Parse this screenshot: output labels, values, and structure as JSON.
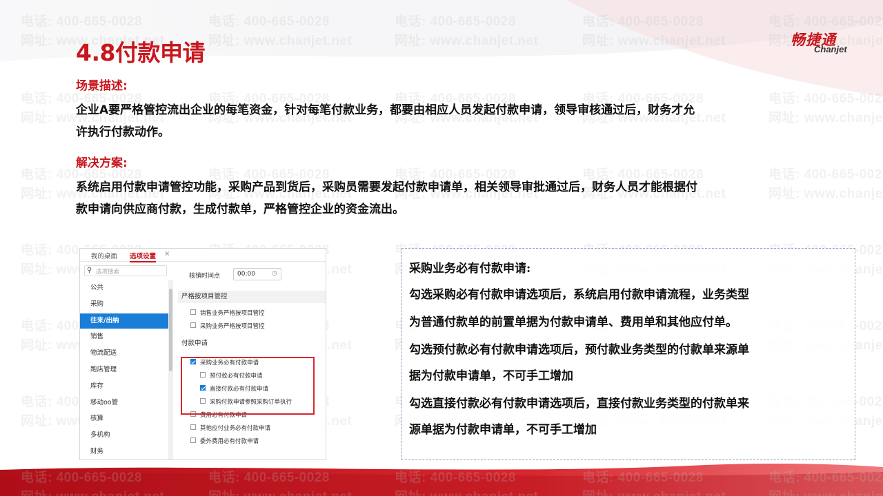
{
  "slide": {
    "title": "4.8付款申请",
    "logo_cn": "畅捷通",
    "logo_en": "Chanjet",
    "watermark_phone": "电话: 400-665-0028",
    "watermark_site": "网址: www.chanjet.net",
    "scene_heading": "场景描述:",
    "scene_lines": [
      "企业A要严格管控流出企业的每笔资金，针对每笔付款业务，都要由相应人员发起付款申请，领导审核通过后，财务才允",
      "许执行付款动作。"
    ],
    "solution_heading": "解决方案:",
    "solution_lines": [
      "系统启用付款申请管控功能，采购产品到货后，采购员需要发起付款申请单，相关领导审批通过后，财务人员才能根据付",
      "款申请向供应商付款，生成付款单，严格管控企业的资金流出。"
    ]
  },
  "screenshot": {
    "tabs": [
      "我的桌面",
      "选项设置"
    ],
    "tab_close": "×",
    "search_placeholder": "选项搜索",
    "sidebar_items": [
      "公共",
      "采购",
      "往来/出纳",
      "销售",
      "物流配送",
      "跑店管理",
      "库存",
      "移动oo管",
      "核算",
      "多机构",
      "财务"
    ],
    "active_sidebar_index": 2,
    "time_label": "核销时间点",
    "time_value": "00:00",
    "section_project": "严格按项目管控",
    "project_options": [
      {
        "label": "销售业务严格按项目管控",
        "checked": false
      },
      {
        "label": "采购业务严格按项目管控",
        "checked": false
      }
    ],
    "section_payment": "付款申请",
    "payment_options": [
      {
        "label": "采购业务必有付款申请",
        "checked": true,
        "indent": 0
      },
      {
        "label": "预付款必有付款申请",
        "checked": false,
        "indent": 1
      },
      {
        "label": "直接付款必有付款申请",
        "checked": true,
        "indent": 1
      },
      {
        "label": "采购付款申请参照采购订单执行",
        "checked": false,
        "indent": 1
      },
      {
        "label": "费用必有付款申请",
        "checked": false,
        "indent": 0
      },
      {
        "label": "其他应付业务必有付款申请",
        "checked": false,
        "indent": 0
      },
      {
        "label": "委外费用必有付款申请",
        "checked": false,
        "indent": 0
      }
    ]
  },
  "description": {
    "lines": [
      "采购业务必有付款申请:",
      "勾选采购必有付款申请选项后，系统启用付款申请流程，业务类型",
      "为普通付款单的前置单据为付款申请单、费用单和其他应付单。",
      "勾选预付款必有付款申请选项后，预付款业务类型的付款单来源单",
      "据为付款申请单，不可手工增加",
      "勾选直接付款必有付款申请选项后，直接付款业务类型的付款单来",
      "源单据为付款申请单，不可手工增加"
    ]
  },
  "colors": {
    "accent": "#c8161d",
    "sidebar_active": "#1a7dd7"
  }
}
